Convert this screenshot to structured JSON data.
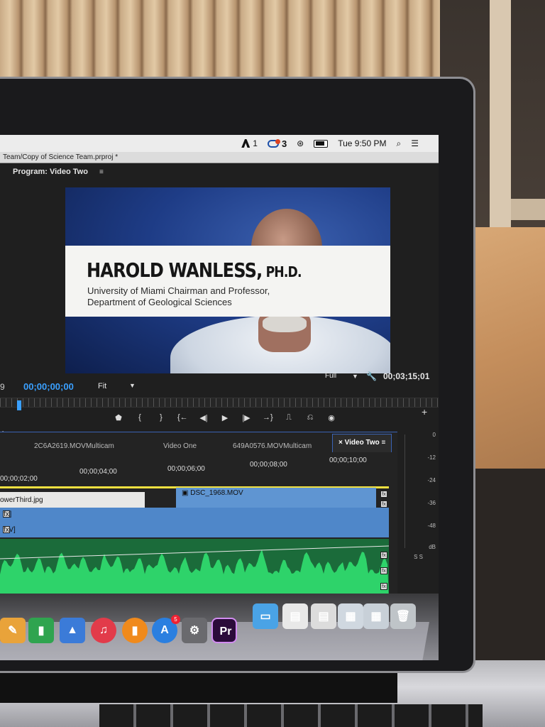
{
  "menubar": {
    "adobe_count": "1",
    "cc_count": "3",
    "clock": "Tue 9:50 PM",
    "search_icon": "magnifier",
    "list_icon": "notification-center"
  },
  "window": {
    "title": "Team/Copy of Science Team.prproj *"
  },
  "program_monitor": {
    "title": "Program: Video Two",
    "menu_glyph": "≡",
    "lower_third": {
      "name": "HAROLD WANLESS,",
      "suffix": " PH.D.",
      "line1": "University of Miami Chairman and Professor,",
      "line2": "Department of Geological Sciences"
    },
    "timecode_current": "00;00;00;00",
    "cut_prefix": "9",
    "zoom": "Fit",
    "resolution": "Full",
    "timecode_duration": "00;03;15;01"
  },
  "transport": {
    "buttons": [
      "marker",
      "mark-in",
      "mark-out",
      "go-to-in",
      "step-back",
      "play",
      "step-forward",
      "go-to-out",
      "lift",
      "extract",
      "export-frame"
    ],
    "glyphs": [
      "⬟",
      "{",
      "}",
      "{←",
      "◀|",
      "▶",
      "|▶",
      "→}",
      "⎍",
      "⎌",
      "◉"
    ]
  },
  "timeline": {
    "tabs": [
      {
        "label": "2C6A2619.MOVMulticam"
      },
      {
        "label": "Video One"
      },
      {
        "label": "649A0576.MOVMulticam"
      }
    ],
    "active_tab": "Video Two",
    "active_tab_close": "×",
    "active_tab_menu": "≡",
    "ruler": [
      "00;00;02;00",
      "00;00;04;00",
      "00;00;06;00",
      "00;00;08;00",
      "00;00;10;00"
    ],
    "clips": {
      "lower_third": "owerThird.jpg",
      "dsc": "DSC_1968.MOV",
      "v1_label_a": "[V]",
      "v1_label_b": "/ [V]"
    },
    "fx_glyph": "fx"
  },
  "meter": {
    "labels": [
      "0",
      "-12",
      "-24",
      "-36",
      "-48",
      "dB"
    ],
    "solo": "S  S"
  },
  "dock": {
    "apps": [
      {
        "name": "pages",
        "glyph": "✎",
        "color": "#e9a33a"
      },
      {
        "name": "numbers",
        "glyph": "▮",
        "color": "#2fa44f"
      },
      {
        "name": "keynote",
        "glyph": "▲",
        "color": "#3b7bd8"
      },
      {
        "name": "itunes",
        "glyph": "♫",
        "color": "#e23b4a"
      },
      {
        "name": "ibooks",
        "glyph": "▮",
        "color": "#f08a1c"
      },
      {
        "name": "app-store",
        "glyph": "A",
        "color": "#2a7fe0",
        "badge": "5"
      },
      {
        "name": "system-preferences",
        "glyph": "⚙",
        "color": "#6a6a6e"
      },
      {
        "name": "premiere-pro",
        "glyph": "Pr",
        "color": "#2b0b3a"
      },
      {
        "name": "folder",
        "glyph": "▭",
        "color": "#4aa3e6"
      },
      {
        "name": "preview-doc",
        "glyph": "▤",
        "color": "#e8e8e8"
      },
      {
        "name": "preview-doc-2",
        "glyph": "▤",
        "color": "#dcdcdc"
      },
      {
        "name": "screenshot-stack",
        "glyph": "▦",
        "color": "#d0d8e0"
      },
      {
        "name": "downloads-stack",
        "glyph": "▦",
        "color": "#c8d0d8"
      },
      {
        "name": "trash",
        "glyph": "🗑",
        "color": "#bfc4c8"
      }
    ]
  }
}
